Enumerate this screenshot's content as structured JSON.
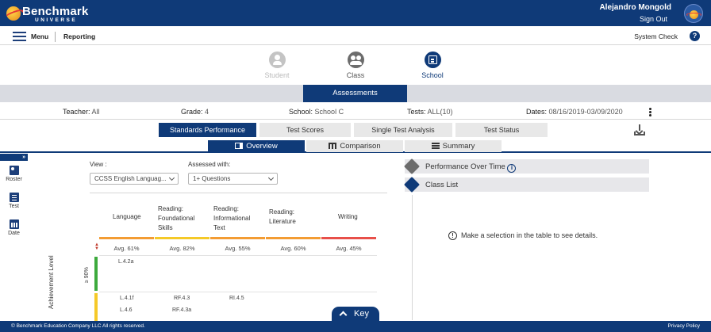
{
  "header": {
    "brand": "Benchmark",
    "brand_sub": "UNIVERSE",
    "user_name": "Alejandro Mongold",
    "sign_out": "Sign Out"
  },
  "nav": {
    "menu": "Menu",
    "section": "Reporting",
    "system_check": "System Check",
    "help": "?"
  },
  "levels": [
    {
      "label": "Student",
      "state": "disabled"
    },
    {
      "label": "Class",
      "state": "enabled"
    },
    {
      "label": "School",
      "state": "selected"
    }
  ],
  "assessments_tab": "Assessments",
  "filters": {
    "teacher_k": "Teacher:",
    "teacher_v": "All",
    "grade_k": "Grade:",
    "grade_v": "4",
    "school_k": "School:",
    "school_v": "School C",
    "tests_k": "Tests:",
    "tests_v": "ALL(10)",
    "dates_k": "Dates:",
    "dates_v": "08/16/2019-03/09/2020"
  },
  "report_tabs": [
    "Standards Performance",
    "Test Scores",
    "Single Test Analysis",
    "Test Status"
  ],
  "view_tabs": [
    "Overview",
    "Comparison",
    "Summary"
  ],
  "rail": {
    "collapse": "»",
    "roster": "Roster",
    "test": "Test",
    "date": "Date"
  },
  "controls": {
    "view_label": "View :",
    "view_value": "CCSS English Languag...",
    "assessed_label": "Assessed with:",
    "assessed_value": "1+ Questions"
  },
  "table": {
    "columns": [
      {
        "name": "Language",
        "avg": "Avg. 61%",
        "color": "#f39c33"
      },
      {
        "name": "Reading: Foundational Skills",
        "avg": "Avg. 82%",
        "color": "#f5c928"
      },
      {
        "name": "Reading: Informational Text",
        "avg": "Avg. 55%",
        "color": "#f39c33"
      },
      {
        "name": "Reading: Literature",
        "avg": "Avg. 60%",
        "color": "#f39c33"
      },
      {
        "name": "Writing",
        "avg": "Avg. 45%",
        "color": "#e8504a"
      }
    ],
    "achievement_label": "Achievement Level",
    "band_label": "≥ 90%",
    "band_colors": {
      "high": "#3daa3d",
      "mid": "#f5c928"
    },
    "high_row": [
      "L.4.2a"
    ],
    "mid_row_1": [
      "L.4.1f",
      "RF.4.3",
      "RI.4.5"
    ],
    "mid_row_2": [
      "L.4.6",
      "RF.4.3a"
    ]
  },
  "key_button": "Key",
  "right_panel": {
    "performance": "Performance Over Time",
    "class_list": "Class List",
    "message": "Make a selection in the table to see details."
  },
  "footer": {
    "copyright": "© Benchmark Education Company LLC All rights reserved.",
    "privacy": "Privacy Policy"
  }
}
